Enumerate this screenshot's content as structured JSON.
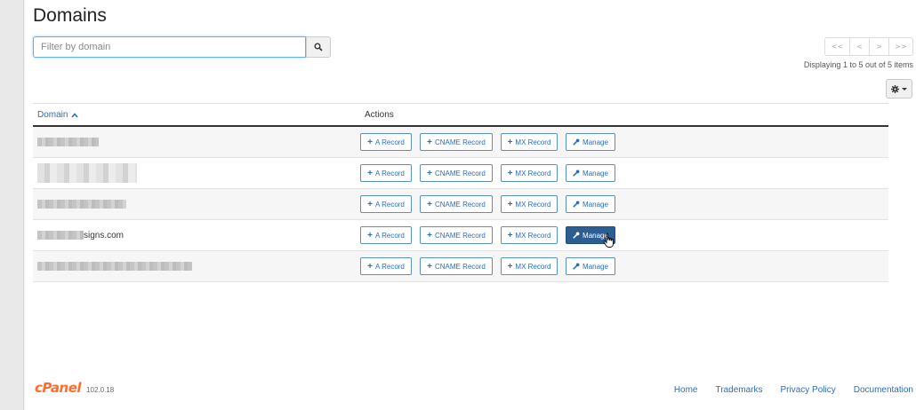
{
  "page": {
    "title": "Domains"
  },
  "search": {
    "placeholder": "Filter by domain"
  },
  "pagination": {
    "first": "<<",
    "prev": "<",
    "next": ">",
    "last": ">>",
    "status": "Displaying 1 to 5 out of 5 items"
  },
  "table": {
    "headers": {
      "domain": "Domain",
      "actions": "Actions"
    },
    "action_labels": {
      "a_record": "A Record",
      "cname_record": "CNAME Record",
      "mx_record": "MX Record",
      "manage": "Manage"
    },
    "rows": [
      {
        "domain_visible": "",
        "redacted": true
      },
      {
        "domain_visible": "",
        "redacted": true
      },
      {
        "domain_visible": "",
        "redacted": true
      },
      {
        "domain_visible": "signs.com",
        "redacted": true
      },
      {
        "domain_visible": "",
        "redacted": true
      }
    ]
  },
  "footer": {
    "logo": "cPanel",
    "version": "102.0.18",
    "links": [
      "Home",
      "Trademarks",
      "Privacy Policy",
      "Documentation"
    ]
  },
  "colors": {
    "accent": "#2a6ebb",
    "manage_active": "#2c5e93",
    "logo": "#ff6c2c"
  }
}
